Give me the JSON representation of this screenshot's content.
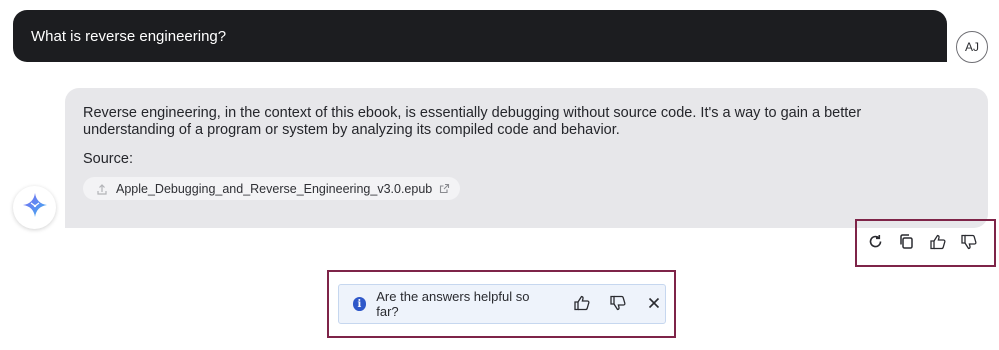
{
  "user_message": {
    "text": "What is reverse engineering?",
    "avatar_initials": "AJ"
  },
  "assistant_message": {
    "text": "Reverse engineering, in the context of this ebook, is essentially debugging without source code. It's a way to gain a better understanding of a program or system by analyzing its compiled code and behavior.",
    "source_label": "Source:",
    "source_file": "Apple_Debugging_and_Reverse_Engineering_v3.0.epub",
    "avatar_icon": "sparkle-star-icon"
  },
  "message_actions": [
    {
      "icon": "refresh-icon",
      "label": "Regenerate"
    },
    {
      "icon": "copy-icon",
      "label": "Copy"
    },
    {
      "icon": "thumbs-up-icon",
      "label": "Like"
    },
    {
      "icon": "thumbs-down-icon",
      "label": "Dislike"
    }
  ],
  "feedback_banner": {
    "text": "Are the answers helpful so far?",
    "icon": "info-icon"
  },
  "colors": {
    "user_bubble": "#1c1d20",
    "assistant_bubble": "#e7e7ea",
    "highlight_border": "#7e2448",
    "info_blue": "#2f58c9"
  }
}
